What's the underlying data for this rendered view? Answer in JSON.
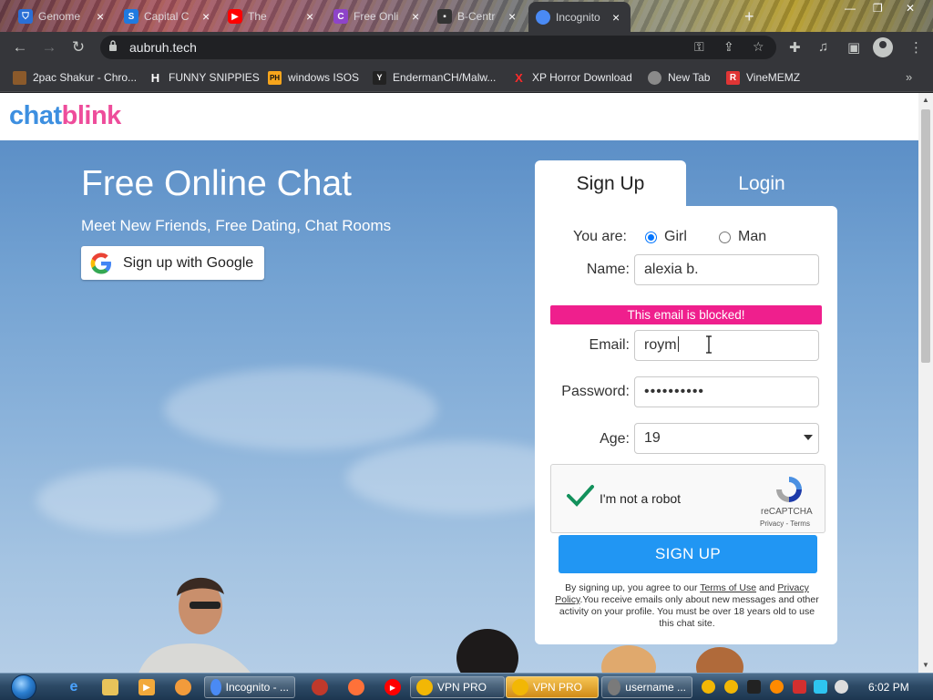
{
  "browser": {
    "tabs": [
      {
        "label": "Genome",
        "color": "#2a6fd6",
        "icon": "shield-icon"
      },
      {
        "label": "Capital C",
        "color": "#1f7ae0",
        "icon": "s-logo-icon"
      },
      {
        "label": "The",
        "color": "#ff0000",
        "icon": "youtube-icon"
      },
      {
        "label": "Free Onli",
        "color": "#8e44c9",
        "icon": "c-logo-icon"
      },
      {
        "label": "B-Centr",
        "color": "#333333",
        "icon": "site-icon"
      },
      {
        "label": "Incognito",
        "color": "#4a8af4",
        "icon": "chrome-icon"
      }
    ],
    "url": "aubruh.tech",
    "bookmarks": [
      {
        "label": "2pac Shakur - Chro...",
        "badge": "",
        "color": "#8b5a2b",
        "icon": "bookmark-favicon-icon"
      },
      {
        "label": "FUNNY SNIPPIES",
        "badge": "H",
        "color": "#ffffff",
        "icon": "bookmark-favicon-icon"
      },
      {
        "label": "windows ISOS",
        "badge": "PH",
        "color": "#f7a51c",
        "icon": "bookmark-favicon-icon"
      },
      {
        "label": "EndermanCH/Malw...",
        "badge": "Y",
        "color": "#ffffff",
        "icon": "bookmark-favicon-icon"
      },
      {
        "label": "XP Horror Download",
        "badge": "X",
        "color": "#ff2a2a",
        "icon": "bookmark-favicon-icon"
      },
      {
        "label": "New Tab",
        "badge": "",
        "color": "#8a8a8a",
        "icon": "globe-icon"
      },
      {
        "label": "VineMEMZ",
        "badge": "R",
        "color": "#e03535",
        "icon": "bookmark-favicon-icon"
      }
    ],
    "more": "»"
  },
  "site": {
    "logo_part1": "chat",
    "logo_part2": "blink",
    "hero_title": "Free Online Chat",
    "hero_subtitle": "Meet New Friends, Free Dating, Chat Rooms",
    "google_button": "Sign up with Google"
  },
  "form": {
    "tab_signup": "Sign Up",
    "tab_login": "Login",
    "you_are_label": "You are:",
    "gender_options": [
      "Girl",
      "Man"
    ],
    "gender_selected": "Girl",
    "name_label": "Name:",
    "name_value": "alexia b.",
    "error_message": "This email is blocked!",
    "email_label": "Email:",
    "email_value": "roym",
    "password_label": "Password:",
    "password_value": "••••••••••",
    "age_label": "Age:",
    "age_value": "19",
    "captcha_text": "I'm not a robot",
    "captcha_brand": "reCAPTCHA",
    "captcha_links": "Privacy - Terms",
    "submit_label": "SIGN UP",
    "terms_prefix": "By signing up, you agree to our ",
    "terms_link": "Terms of Use",
    "terms_and": " and ",
    "privacy_link": "Privacy Policy",
    "terms_rest": ".You receive emails only about new messages and other activity on your profile. You must be over 18 years old to use this chat site.",
    "accent_pink": "#ef1f8d",
    "accent_blue": "#2196f3"
  },
  "taskbar": {
    "items": [
      {
        "label": "Incognito - ...",
        "color": "#4a8af4",
        "icon": "chrome-icon"
      },
      {
        "label": "VPN PRO",
        "color": "#f2b705",
        "icon": "vpn-icon"
      },
      {
        "label": "VPN PRO",
        "color": "#f2b705",
        "icon": "vpn-icon"
      },
      {
        "label": "username ...",
        "color": "#7a7a7a",
        "icon": "app-icon"
      }
    ],
    "clock": "6:02 PM"
  }
}
